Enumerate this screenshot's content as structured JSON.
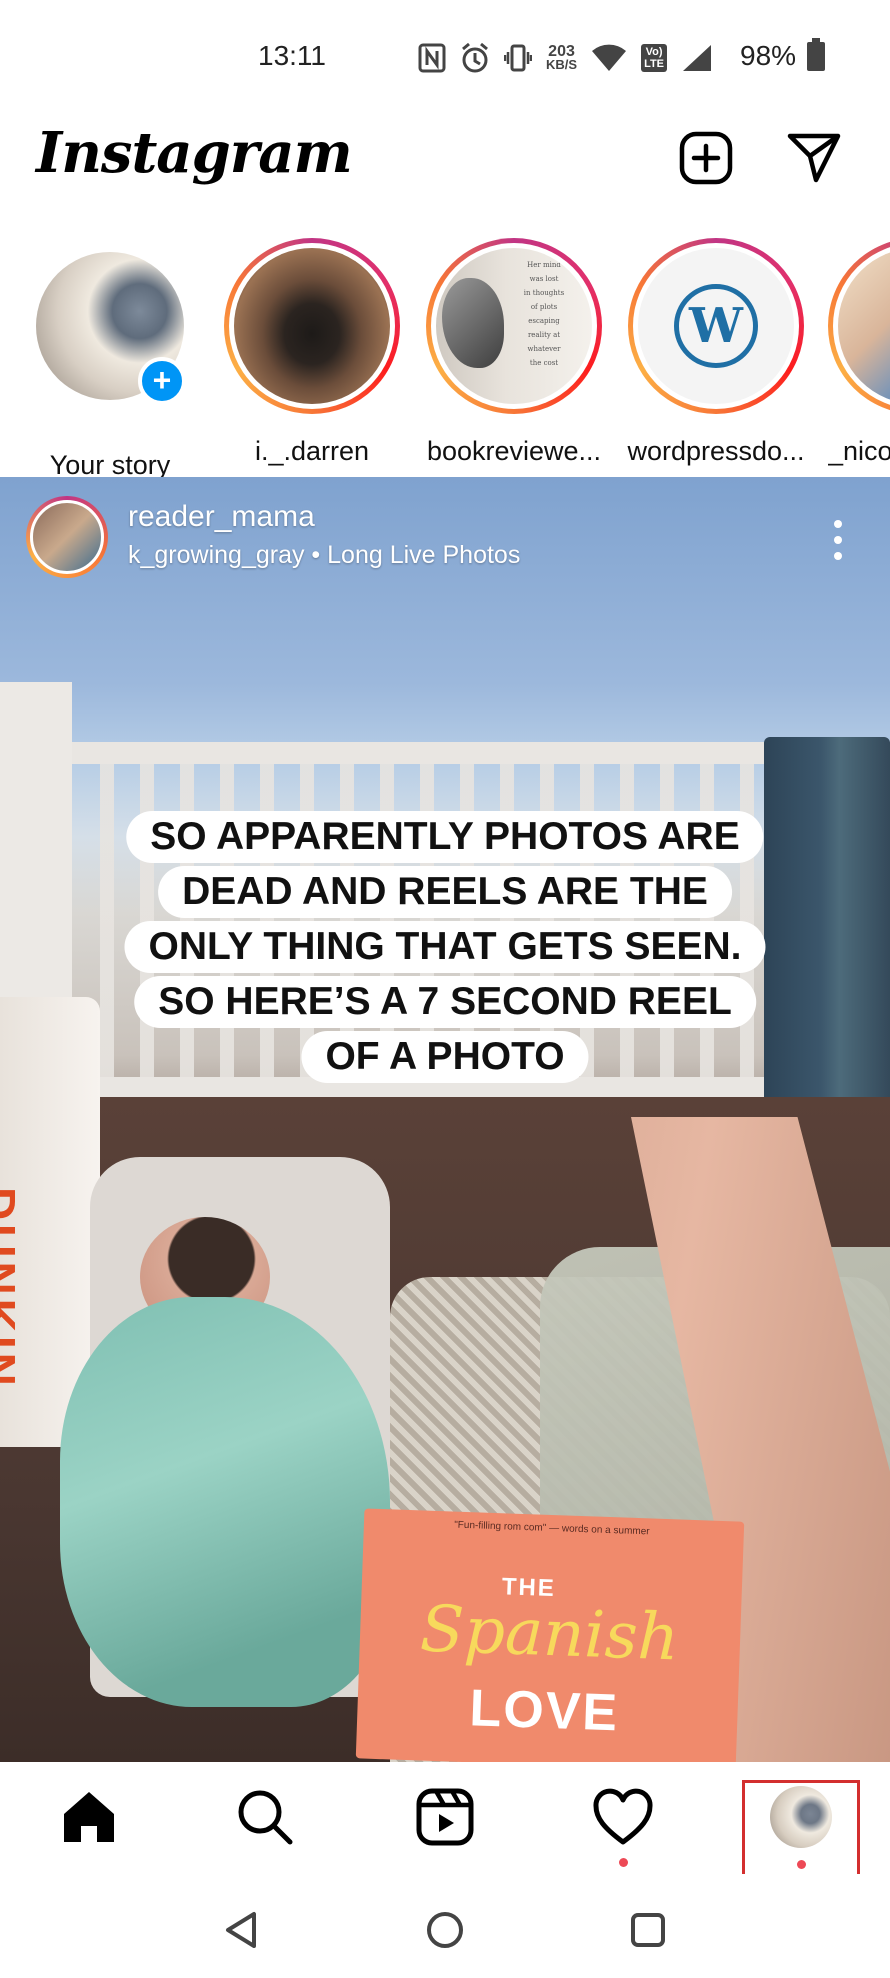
{
  "status_bar": {
    "time": "13:11",
    "network_speed_value": "203",
    "network_speed_unit": "KB/S",
    "volte_top": "Vo)",
    "volte_bottom": "LTE",
    "battery_percent": "98%",
    "icons": [
      "nfc-icon",
      "alarm-icon",
      "vibrate-icon",
      "network-speed-icon",
      "wifi-icon",
      "volte-icon",
      "signal-icon",
      "battery-icon"
    ]
  },
  "header": {
    "logo_text": "Instagram",
    "icons": [
      "add-post-icon",
      "direct-message-icon"
    ]
  },
  "stories": [
    {
      "label": "Your story",
      "has_ring": false
    },
    {
      "label": "i._.darren",
      "has_ring": true
    },
    {
      "label": "bookreviewe...",
      "has_ring": true
    },
    {
      "label": "wordpressdo...",
      "has_ring": true
    },
    {
      "label": "_nico",
      "has_ring": true
    }
  ],
  "story_snippets": {
    "book_text": [
      "Her mind",
      "was lost",
      "in thoughts",
      "of plots",
      "escaping",
      "reality at",
      "whatever",
      "the cost"
    ],
    "wp_letter": "W"
  },
  "post": {
    "username": "reader_mama",
    "subtitle": "k_growing_gray • Long Live Photos",
    "caption_lines": [
      "SO APPARENTLY PHOTOS ARE",
      "DEAD AND REELS ARE THE",
      "ONLY THING THAT GETS SEEN.",
      "SO HERE’S A 7 SECOND REEL",
      "OF A PHOTO"
    ],
    "book": {
      "blurb": "\"Fun-filling rom com\" — words on a summer",
      "title_the": "THE",
      "title_spanish": "Spanish",
      "title_love": "LOVE"
    },
    "cup_text": "DUNKIN"
  },
  "bottom_nav": {
    "items": [
      "home-icon",
      "search-icon",
      "reels-icon",
      "activity-heart-icon",
      "profile-avatar"
    ],
    "notification_dots": [
      "activity",
      "profile"
    ],
    "highlighted": "profile"
  },
  "system_nav": [
    "back-icon",
    "home-circle-icon",
    "recents-icon"
  ],
  "colors": {
    "accent_blue": "#0095f6",
    "notification_red": "#ed4956",
    "highlight_box": "#d32f2f"
  }
}
